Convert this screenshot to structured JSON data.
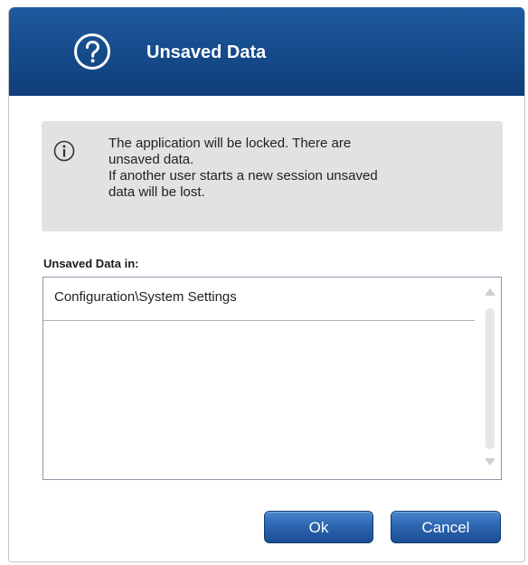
{
  "dialog": {
    "title": "Unsaved Data",
    "title_icon": "question-circle-icon",
    "colors": {
      "titlebar": "#154a8a",
      "info_box": "#e2e2e2",
      "button": "#2a63ad"
    }
  },
  "info": {
    "icon": "info-circle-icon",
    "line1": "The application will be locked. There are",
    "line2": "unsaved data.",
    "line3": "If another user starts a new session unsaved",
    "line4": "data will be lost."
  },
  "list": {
    "label": "Unsaved Data in:",
    "items": [
      {
        "label": "Configuration\\System Settings"
      }
    ]
  },
  "buttons": {
    "ok_label": "Ok",
    "cancel_label": "Cancel"
  }
}
